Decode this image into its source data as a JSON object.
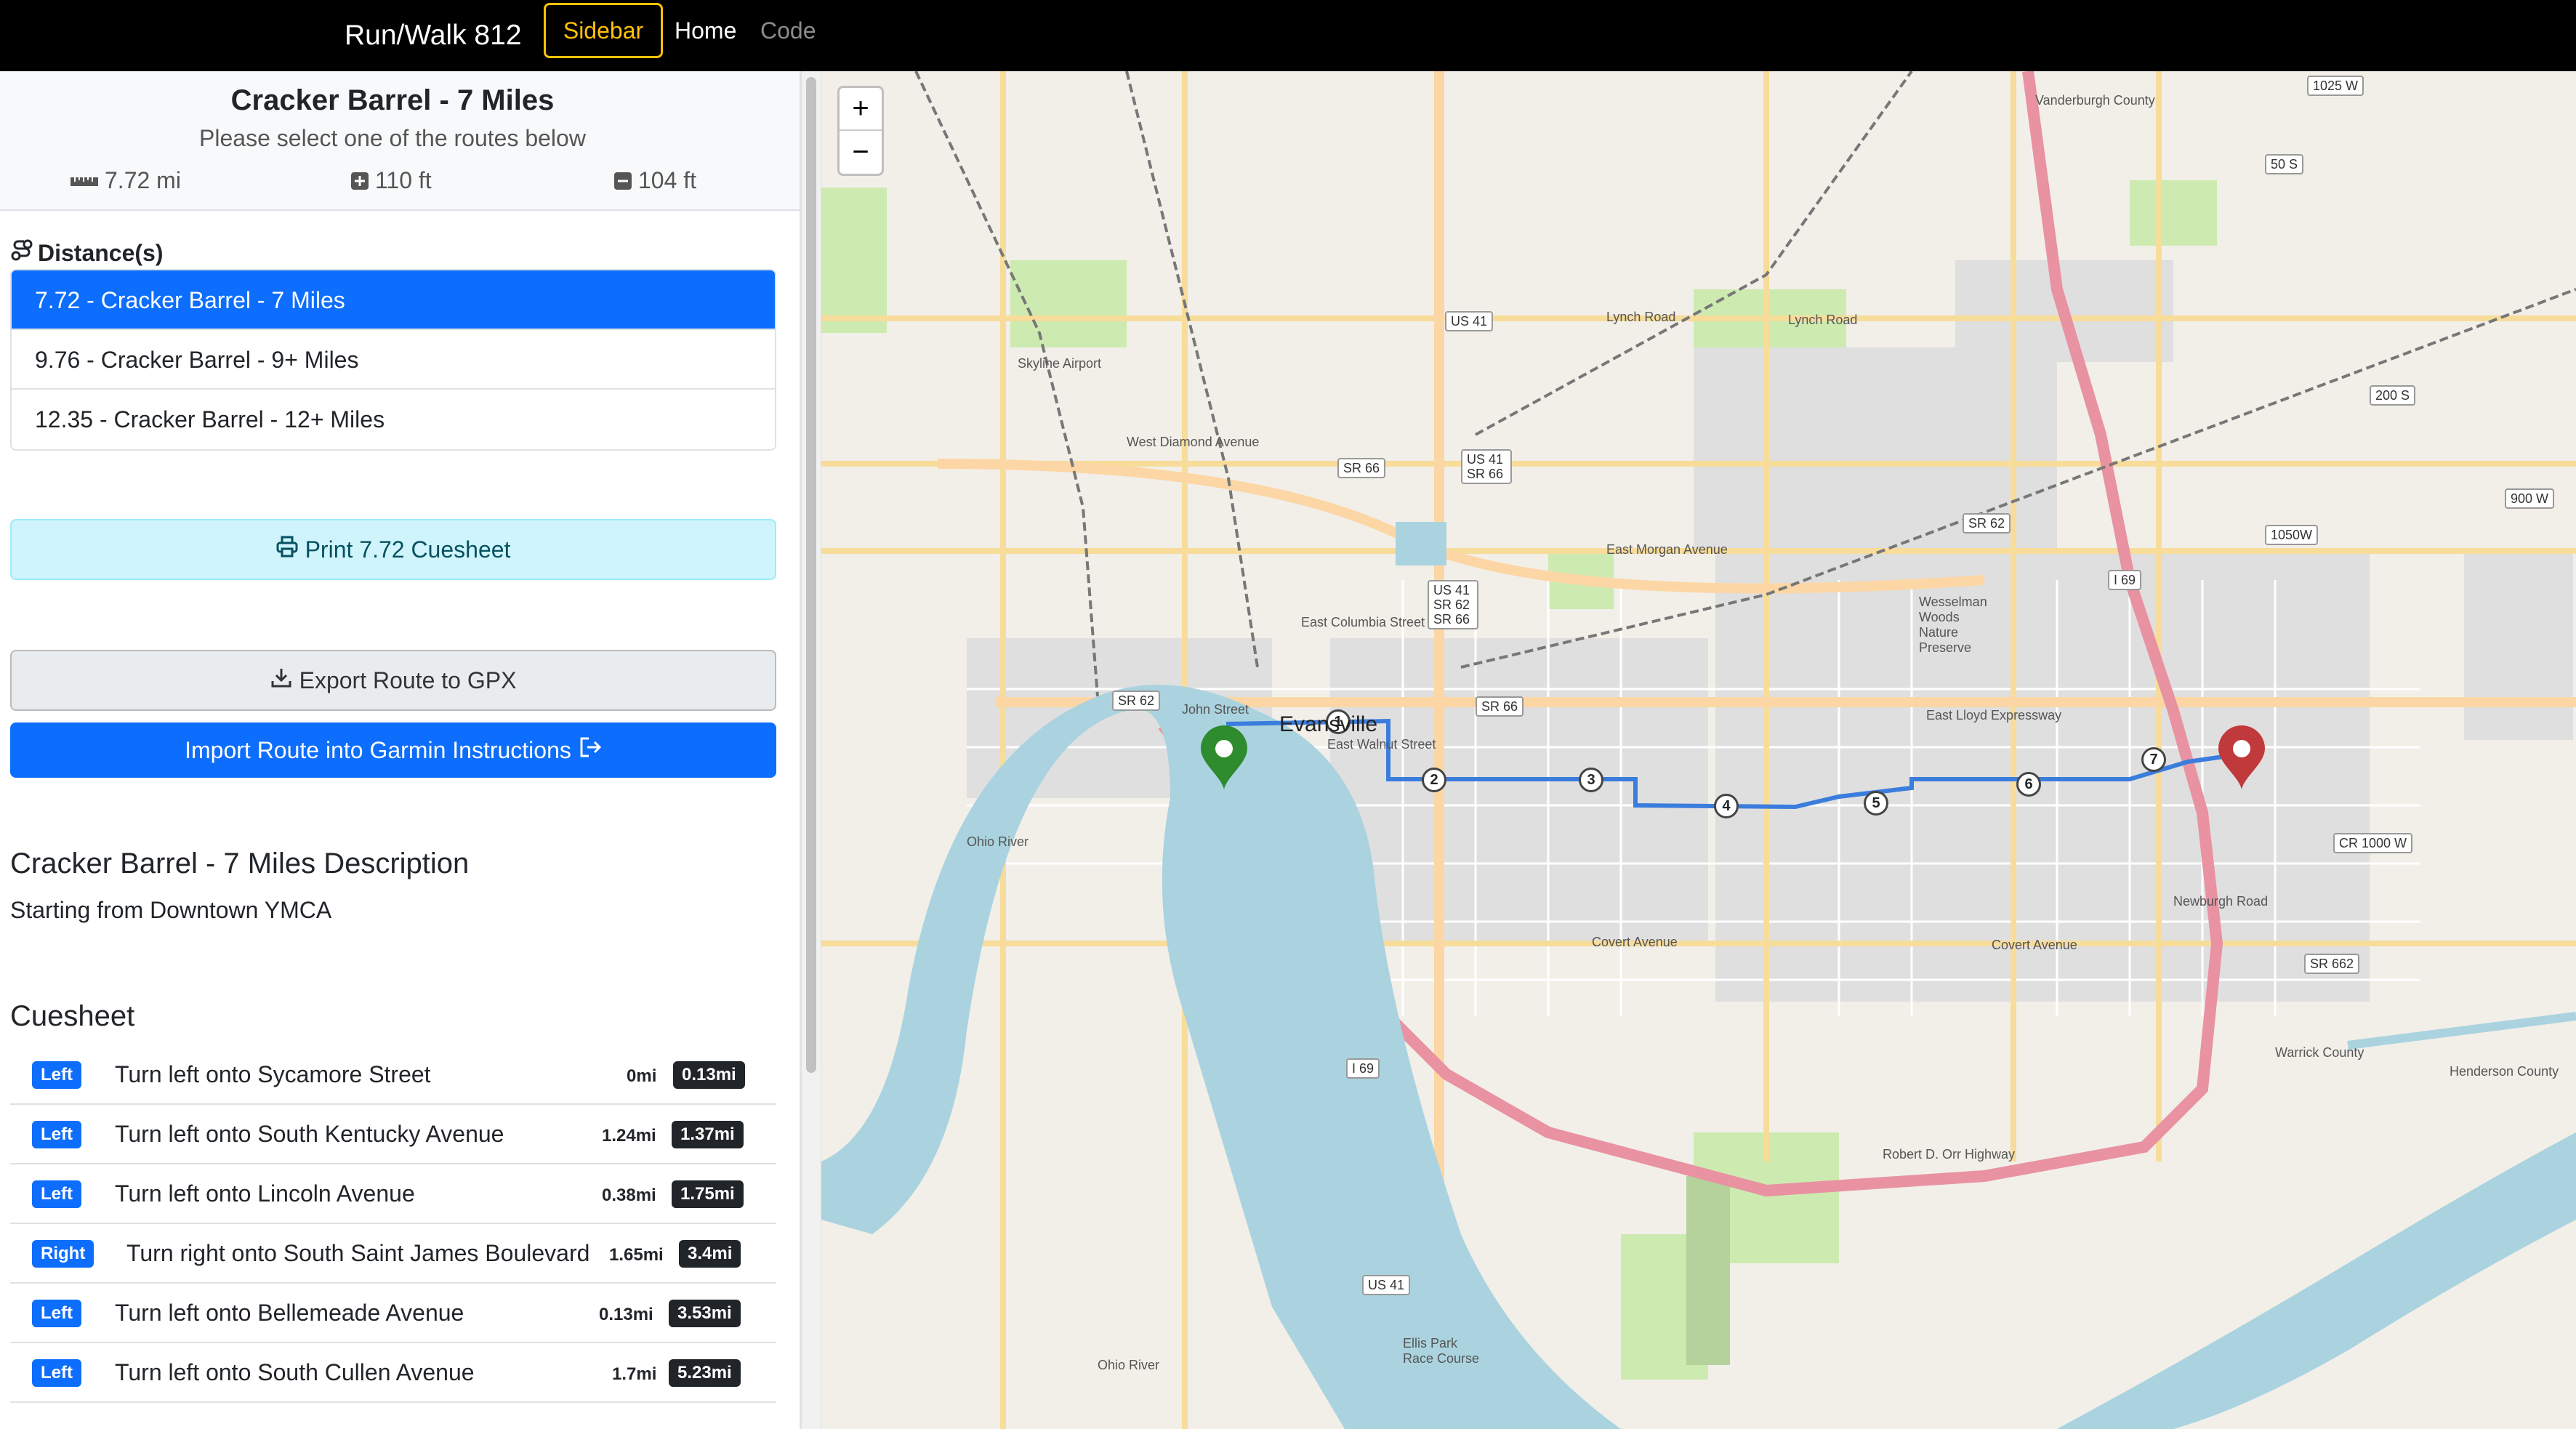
{
  "navbar": {
    "brand": "Run/Walk 812",
    "sidebar_label": "Sidebar",
    "home_label": "Home",
    "code_label": "Code"
  },
  "route": {
    "title": "Cracker Barrel - 7 Miles",
    "subtitle": "Please select one of the routes below",
    "distance": "7.72 mi",
    "elevation_gain": "110 ft",
    "elevation_loss": "104 ft"
  },
  "distances": {
    "label": "Distance(s)",
    "items": [
      {
        "label": "7.72 - Cracker Barrel - 7 Miles",
        "active": true
      },
      {
        "label": "9.76 - Cracker Barrel - 9+ Miles",
        "active": false
      },
      {
        "label": "12.35 - Cracker Barrel - 12+ Miles",
        "active": false
      }
    ]
  },
  "actions": {
    "print_label": "Print 7.72 Cuesheet",
    "export_label": "Export Route to GPX",
    "import_label": "Import Route into Garmin Instructions"
  },
  "description": {
    "title": "Cracker Barrel - 7 Miles Description",
    "text": "Starting from Downtown YMCA"
  },
  "cuesheet": {
    "title": "Cuesheet",
    "rows": [
      {
        "dir": "Left",
        "text": "Turn left onto Sycamore Street",
        "dist": "0mi",
        "total": "0.13mi"
      },
      {
        "dir": "Left",
        "text": "Turn left onto South Kentucky Avenue",
        "dist": "1.24mi",
        "total": "1.37mi"
      },
      {
        "dir": "Left",
        "text": "Turn left onto Lincoln Avenue",
        "dist": "0.38mi",
        "total": "1.75mi"
      },
      {
        "dir": "Right",
        "text": "Turn right onto South Saint James Boulevard",
        "dist": "1.65mi",
        "total": "3.4mi"
      },
      {
        "dir": "Left",
        "text": "Turn left onto Bellemeade Avenue",
        "dist": "0.13mi",
        "total": "3.53mi"
      },
      {
        "dir": "Left",
        "text": "Turn left onto South Cullen Avenue",
        "dist": "1.7mi",
        "total": "5.23mi"
      }
    ]
  },
  "map": {
    "zoom_in": "+",
    "zoom_out": "−",
    "city": "Evansville",
    "waypoints": [
      "1",
      "2",
      "3",
      "4",
      "5",
      "6",
      "7"
    ],
    "labels": {
      "vanderburgh_county": "Vanderburgh County",
      "skyline_airport": "Skyline Airport",
      "lynch_road": "Lynch Road",
      "west_diamond_ave": "West Diamond Avenue",
      "east_morgan_ave": "East Morgan Avenue",
      "east_columbia_st": "East Columbia Street",
      "east_lloyd_expy": "East Lloyd Expressway",
      "covert_ave": "Covert Avenue",
      "newburgh_road": "Newburgh Road",
      "ohio_river": "Ohio River",
      "wesselman": "Wesselman Woods Nature Preserve",
      "robert_d_orr": "Robert D. Orr Highway",
      "ellis_park": "Ellis Park Race Course",
      "warrick_county": "Warrick County",
      "henderson_county": "Henderson County",
      "john_street": "John Street",
      "east_walnut_st": "East Walnut Street"
    },
    "shields": {
      "us41_a": "US 41",
      "us41_sr66": "US 41 SR 66",
      "sr66_a": "SR 66",
      "us41_sr62_66": "US 41 SR 62 SR 66",
      "sr62_a": "SR 62",
      "sr62_b": "SR 62",
      "sr66_b": "SR 66",
      "i69_a": "I 69",
      "i69_b": "I 69",
      "us41_b": "US 41",
      "cr1000w": "CR 1000 W",
      "sr662": "SR 662",
      "r1025w": "1025 W",
      "r50s": "50 S",
      "r200s": "200 S",
      "r900w": "900 W",
      "r1050w": "1050W"
    },
    "colors": {
      "route": "#3b7ddd",
      "start_pin": "#2e8b2e",
      "end_pin": "#c0393b",
      "river": "#aad3df",
      "highway": "#e892a2"
    }
  }
}
